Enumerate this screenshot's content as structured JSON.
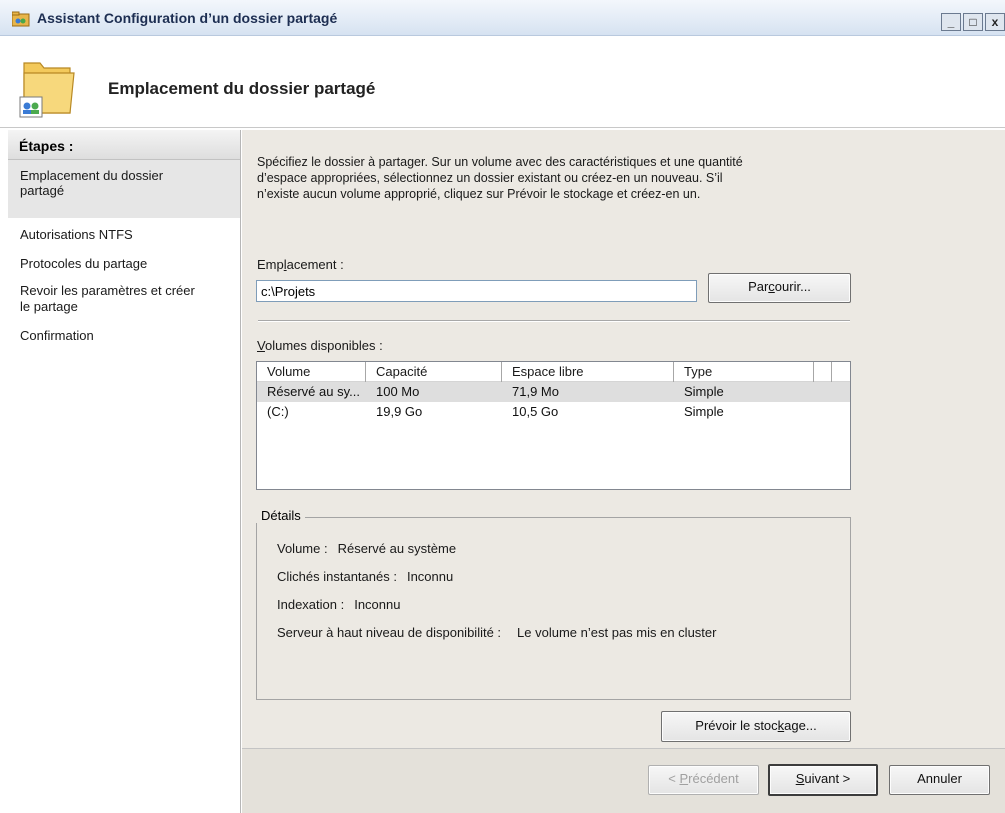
{
  "window": {
    "title": "Assistant Configuration d’un dossier partagé",
    "controls": {
      "minimize": "_",
      "maximize": "□",
      "close": "x"
    }
  },
  "header": {
    "title": "Emplacement du dossier partagé",
    "icon": "folder-share-icon"
  },
  "steps": {
    "heading": "Étapes :",
    "items": [
      {
        "label_l1": "Emplacement du dossier",
        "label_l2": "partagé",
        "active": true
      },
      {
        "label_l1": "Autorisations NTFS",
        "label_l2": "",
        "active": false
      },
      {
        "label_l1": "Protocoles du partage",
        "label_l2": "",
        "active": false
      },
      {
        "label_l1": "Revoir les paramètres et créer",
        "label_l2": "le partage",
        "active": false
      },
      {
        "label_l1": "Confirmation",
        "label_l2": "",
        "active": false
      }
    ]
  },
  "main": {
    "intro": {
      "line1": "Spécifiez le dossier à partager. Sur un volume avec des caractéristiques et une quantité",
      "line2": "d’espace appropriées, sélectionnez un dossier existant ou créez-en un nouveau. S’il",
      "line3": "n’existe aucun volume approprié, cliquez sur Prévoir le stockage et créez-en un."
    },
    "location": {
      "label_pre": "Emp",
      "label_u": "l",
      "label_post": "acement :",
      "value": "c:\\Projets",
      "browse_pre": "Par",
      "browse_u": "c",
      "browse_post": "ourir..."
    },
    "volumes": {
      "label_u": "V",
      "label_post": "olumes disponibles :",
      "columns": [
        "Volume",
        "Capacité",
        "Espace libre",
        "Type"
      ],
      "rows": [
        {
          "volume": "Réservé au sy...",
          "capacity": "100 Mo",
          "free": "71,9 Mo",
          "type": "Simple",
          "selected": true
        },
        {
          "volume": "(C:)",
          "capacity": "19,9 Go",
          "free": "10,5 Go",
          "type": "Simple",
          "selected": false
        }
      ]
    },
    "details": {
      "legend": "Détails",
      "volume_label": "Volume :",
      "volume_value": "Réservé au système",
      "snapshots_label": "Clichés instantanés :",
      "snapshots_value": "Inconnu",
      "indexing_label": "Indexation :",
      "indexing_value": "Inconnu",
      "ha_label": "Serveur à haut niveau de disponibilité :",
      "ha_value": "Le volume n’est pas mis en cluster"
    },
    "provision": {
      "pre": "Prévoir le stoc",
      "u": "k",
      "post": "age..."
    }
  },
  "footer": {
    "back": {
      "pre": "< ",
      "u": "P",
      "post": "récédent"
    },
    "next": {
      "u": "S",
      "post": "uivant >"
    },
    "cancel": "Annuler"
  },
  "colors": {
    "content_bg": "#ece9e3",
    "selection": "#dedede",
    "title_text": "#1d2e52"
  }
}
